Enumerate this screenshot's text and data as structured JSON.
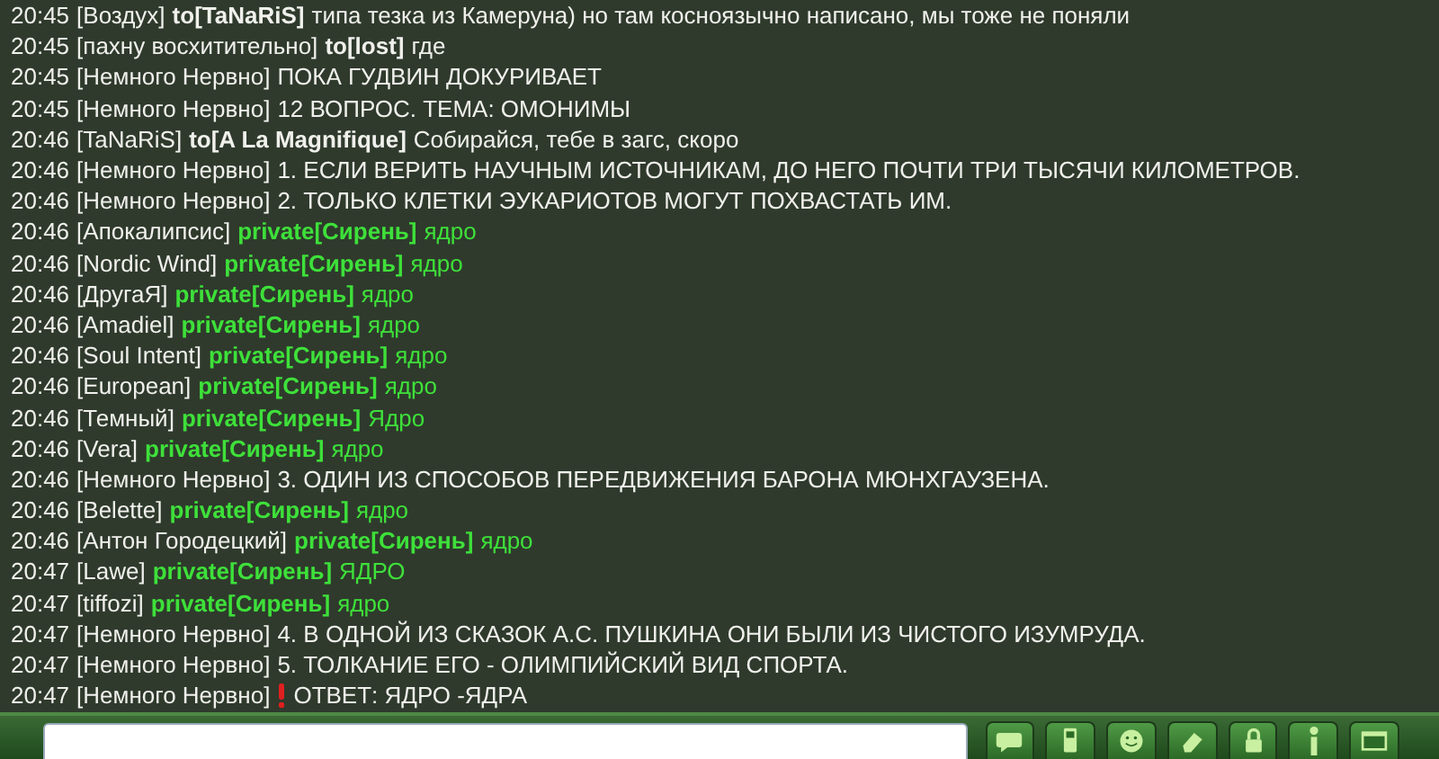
{
  "messages": [
    {
      "time": "20:45",
      "nick": "[Воздух]",
      "kind": "to",
      "target": "to[TaNaRiS]",
      "text": "типа тезка из Камеруна) но там косноязычно написано, мы тоже не поняли"
    },
    {
      "time": "20:45",
      "nick": "[пахну восхитительно]",
      "kind": "to",
      "target": "to[lost]",
      "text": "где"
    },
    {
      "time": "20:45",
      "nick": "[Немного Нервно]",
      "kind": "public",
      "text": "ПОКА ГУДВИН ДОКУРИВАЕТ"
    },
    {
      "time": "20:45",
      "nick": "[Немного Нервно]",
      "kind": "public",
      "text": "12 ВОПРОС. ТЕМА: ОМОНИМЫ"
    },
    {
      "time": "20:46",
      "nick": "[TaNaRiS]",
      "kind": "to",
      "target": "to[A La Magnifique]",
      "text": "Собирайся, тебе в загс, скоро"
    },
    {
      "time": "20:46",
      "nick": "[Немного Нервно]",
      "kind": "public",
      "text": "1. ЕСЛИ ВЕРИТЬ НАУЧНЫМ ИСТОЧНИКАМ, ДО НЕГО ПОЧТИ ТРИ ТЫСЯЧИ КИЛОМЕТРОВ."
    },
    {
      "time": "20:46",
      "nick": "[Немного Нервно]",
      "kind": "public",
      "text": "2. ТОЛЬКО КЛЕТКИ ЭУКАРИОТОВ МОГУТ ПОХВАСТАТЬ ИМ."
    },
    {
      "time": "20:46",
      "nick": "[Апокалипсис]",
      "kind": "private",
      "target": "private[Сирень]",
      "text": "ядро"
    },
    {
      "time": "20:46",
      "nick": "[Nordic Wind]",
      "kind": "private",
      "target": "private[Сирень]",
      "text": "ядро"
    },
    {
      "time": "20:46",
      "nick": "[ДругаЯ]",
      "kind": "private",
      "target": "private[Сирень]",
      "text": "ядро"
    },
    {
      "time": "20:46",
      "nick": "[Amadiel]",
      "kind": "private",
      "target": "private[Сирень]",
      "text": "ядро"
    },
    {
      "time": "20:46",
      "nick": "[Soul Intent]",
      "kind": "private",
      "target": "private[Сирень]",
      "text": "ядро"
    },
    {
      "time": "20:46",
      "nick": "[European]",
      "kind": "private",
      "target": "private[Сирень]",
      "text": "ядро"
    },
    {
      "time": "20:46",
      "nick": "[Темный]",
      "kind": "private",
      "target": "private[Сирень]",
      "text": "Ядро"
    },
    {
      "time": "20:46",
      "nick": "[Vera]",
      "kind": "private",
      "target": "private[Сирень]",
      "text": "ядро"
    },
    {
      "time": "20:46",
      "nick": "[Немного Нервно]",
      "kind": "public",
      "text": "3. ОДИН ИЗ СПОСОБОВ ПЕРЕДВИЖЕНИЯ БАРОНА МЮНХГАУЗЕНА."
    },
    {
      "time": "20:46",
      "nick": "[Belette]",
      "kind": "private",
      "target": "private[Сирень]",
      "text": "ядро"
    },
    {
      "time": "20:46",
      "nick": "[Антон Городецкий]",
      "kind": "private",
      "target": "private[Сирень]",
      "text": "ядро"
    },
    {
      "time": "20:47",
      "nick": "[Lawe]",
      "kind": "private",
      "target": "private[Сирень]",
      "text": "ЯДРО"
    },
    {
      "time": "20:47",
      "nick": "[tiffozi]",
      "kind": "private",
      "target": "private[Сирень]",
      "text": "ядро"
    },
    {
      "time": "20:47",
      "nick": "[Немного Нервно]",
      "kind": "public",
      "text": "4. В ОДНОЙ ИЗ СКАЗОК А.С. ПУШКИНА ОНИ БЫЛИ ИЗ ЧИСТОГО ИЗУМРУДА."
    },
    {
      "time": "20:47",
      "nick": "[Немного Нервно]",
      "kind": "public",
      "text": "5. ТОЛКАНИЕ ЕГО - ОЛИМПИЙСКИЙ ВИД СПОРТА."
    },
    {
      "time": "20:47",
      "nick": "[Немного Нервно]",
      "kind": "alert",
      "text": "ОТВЕТ: ЯДРО -ЯДРА"
    }
  ],
  "toolbar": [
    {
      "kind": "chat"
    },
    {
      "kind": "phone"
    },
    {
      "kind": "smiley"
    },
    {
      "kind": "eraser"
    },
    {
      "kind": "lock"
    },
    {
      "kind": "info"
    },
    {
      "kind": "screen"
    }
  ]
}
